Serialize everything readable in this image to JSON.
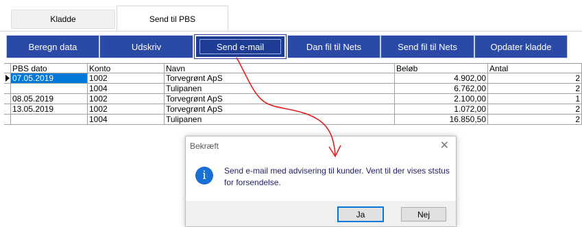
{
  "tabs": [
    {
      "label": "Kladde"
    },
    {
      "label": "Send til PBS"
    }
  ],
  "toolbar": {
    "buttons": [
      "Beregn data",
      "Udskriv",
      "Send e-mail",
      "Dan fil til Nets",
      "Send fil til Nets",
      "Opdater kladde"
    ]
  },
  "grid": {
    "headers": [
      "PBS dato",
      "Konto",
      "Navn",
      "Beløb",
      "Antal"
    ],
    "rows": [
      {
        "date": "07.05.2019",
        "konto": "1002",
        "navn": "Torvegrønt ApS",
        "belob": "4.902,00",
        "antal": "2"
      },
      {
        "date": "",
        "konto": "1004",
        "navn": "Tulipanen",
        "belob": "6.762,00",
        "antal": "2"
      },
      {
        "date": "08.05.2019",
        "konto": "1002",
        "navn": "Torvegrønt ApS",
        "belob": "2.100,00",
        "antal": "1"
      },
      {
        "date": "13.05.2019",
        "konto": "1002",
        "navn": "Torvegrønt ApS",
        "belob": "1.072,00",
        "antal": "2"
      },
      {
        "date": "",
        "konto": "1004",
        "navn": "Tulipanen",
        "belob": "16.850,50",
        "antal": "2"
      }
    ]
  },
  "dialog": {
    "title": "Bekræft",
    "close": "✕",
    "icon": "i",
    "message": "Send e-mail med advisering til kunder. Vent til der vises ststus for forsendelse.",
    "yes": "Ja",
    "no": "Nej"
  },
  "colors": {
    "toolbar_button": "#2b4aa5",
    "selection": "#0078d7",
    "annotation_arrow": "#e02020"
  }
}
